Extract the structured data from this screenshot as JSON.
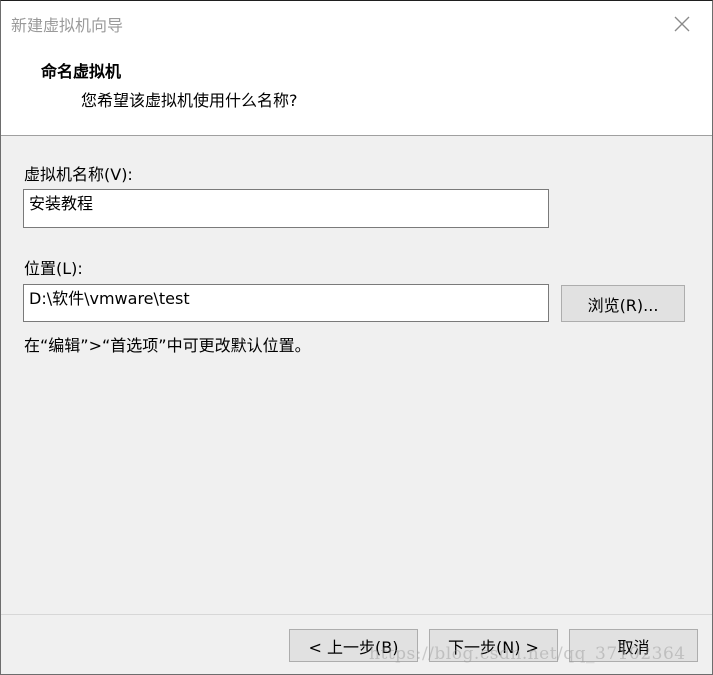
{
  "window": {
    "title": "新建虚拟机向导",
    "close_icon": "close-icon"
  },
  "header": {
    "title": "命名虚拟机",
    "subtitle": "您希望该虚拟机使用什么名称?"
  },
  "form": {
    "name_label": "虚拟机名称(V):",
    "name_value": "安装教程",
    "location_label": "位置(L):",
    "location_value": "D:\\软件\\vmware\\test",
    "browse_label": "浏览(R)...",
    "hint": "在“编辑”>“首选项”中可更改默认位置。"
  },
  "footer": {
    "back_label": "< 上一步(B)",
    "next_label": "下一步(N) >",
    "cancel_label": "取消"
  },
  "watermark": "https://blog.csdn.net/qq_37102364",
  "colors": {
    "title_text": "#9a9a9a",
    "dialog_background": "#f0f0f0",
    "button_background": "#e1e1e1"
  }
}
